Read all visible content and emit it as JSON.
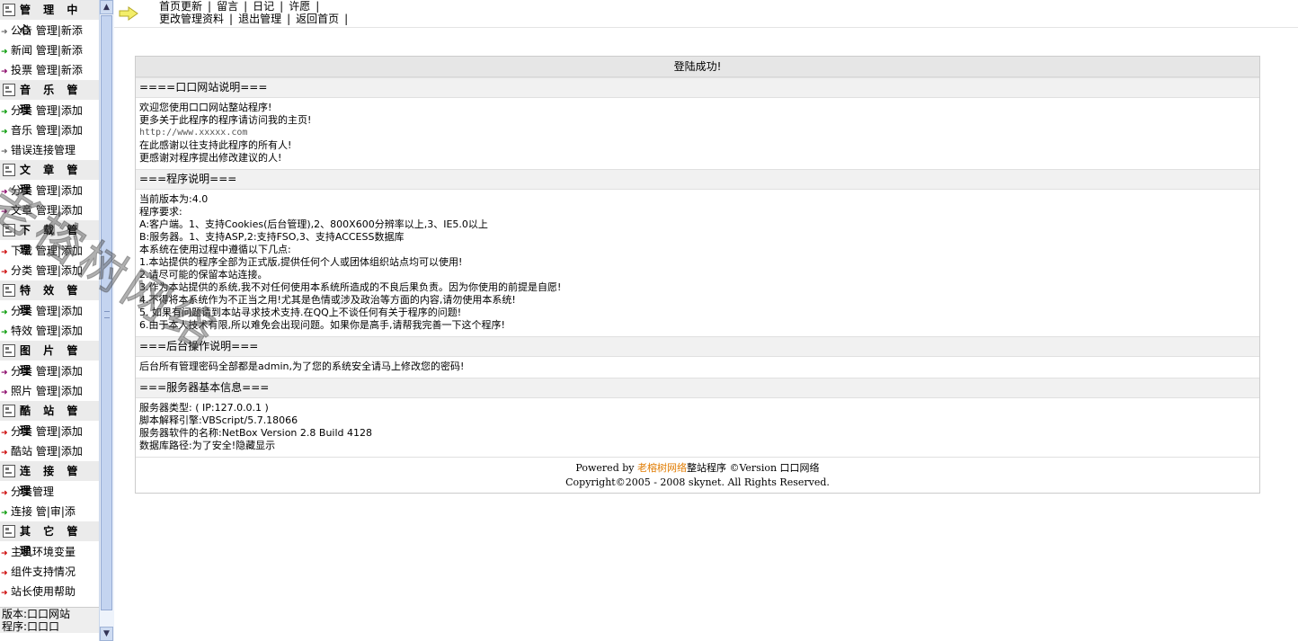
{
  "sidebar": {
    "sections": [
      {
        "title": "管 理 中 心",
        "items": [
          {
            "label": "公告 管理|新添",
            "arrow": "gray"
          },
          {
            "label": "新闻 管理|新添",
            "arrow": "green"
          },
          {
            "label": "投票 管理|新添",
            "arrow": "purple"
          }
        ]
      },
      {
        "title": "音 乐 管 理",
        "items": [
          {
            "label": "分类 管理|添加",
            "arrow": "green"
          },
          {
            "label": "音乐 管理|添加",
            "arrow": "green"
          },
          {
            "label": "错误连接管理",
            "arrow": "gray"
          }
        ]
      },
      {
        "title": "文 章 管 理",
        "items": [
          {
            "label": "分类 管理|添加",
            "arrow": "purple"
          },
          {
            "label": "文章 管理|添加",
            "arrow": "purple"
          }
        ]
      },
      {
        "title": "下 载 管 理",
        "items": [
          {
            "label": "下载 管理|添加",
            "arrow": "red"
          },
          {
            "label": "分类 管理|添加",
            "arrow": "red"
          }
        ]
      },
      {
        "title": "特 效 管 理",
        "items": [
          {
            "label": "分类 管理|添加",
            "arrow": "green"
          },
          {
            "label": "特效 管理|添加",
            "arrow": "green"
          }
        ]
      },
      {
        "title": "图 片 管 理",
        "items": [
          {
            "label": "分类 管理|添加",
            "arrow": "purple"
          },
          {
            "label": "照片 管理|添加",
            "arrow": "purple"
          }
        ]
      },
      {
        "title": "酷 站 管 理",
        "items": [
          {
            "label": "分类 管理|添加",
            "arrow": "red"
          },
          {
            "label": "酷站 管理|添加",
            "arrow": "red"
          }
        ]
      },
      {
        "title": "连 接 管 理",
        "items": [
          {
            "label": "分类管理",
            "arrow": "red"
          },
          {
            "label": "连接 管|审|添",
            "arrow": "green"
          }
        ]
      },
      {
        "title": "其 它 管 理",
        "items": [
          {
            "label": "主机环境变量",
            "arrow": "red"
          },
          {
            "label": "组件支持情况",
            "arrow": "red"
          },
          {
            "label": "站长使用帮助",
            "arrow": "red"
          }
        ]
      }
    ],
    "version_label": "版本:口口网站",
    "program_label": "程序:口口口"
  },
  "topnav": {
    "row1": [
      "首页更新",
      "留言",
      "日记",
      "许愿"
    ],
    "row2": [
      "更改管理资料",
      "退出管理",
      "返回首页"
    ]
  },
  "content": {
    "header": "登陆成功!",
    "sections": [
      {
        "title": "====口口网站说明===",
        "lines": [
          {
            "text": "欢迎您使用口口网站整站程序!"
          },
          {
            "text": "更多关于此程序的程序请访问我的主页!"
          },
          {
            "text": "http://www.xxxxx.com",
            "mono": true
          },
          {
            "text": "在此感谢以往支持此程序的所有人!"
          },
          {
            "text": "更感谢对程序提出修改建议的人!"
          }
        ]
      },
      {
        "title": "===程序说明===",
        "lines": [
          {
            "text": "当前版本为:4.0"
          },
          {
            "text": "程序要求:"
          },
          {
            "text": "A:客户端。1、支持Cookies(后台管理),2、800X600分辨率以上,3、IE5.0以上"
          },
          {
            "text": "B:服务器。1、支持ASP,2:支持FSO,3、支持ACCESS数据库"
          },
          {
            "text": "本系统在使用过程中遵循以下几点:"
          },
          {
            "text": "1.本站提供的程序全部为正式版,提供任何个人或团体组织站点均可以使用!"
          },
          {
            "text": "2.请尽可能的保留本站连接。"
          },
          {
            "text": "3.作为本站提供的系统,我不对任何使用本系统所造成的不良后果负责。因为你使用的前提是自愿!"
          },
          {
            "text": "4.不得将本系统作为不正当之用!尤其是色情或涉及政治等方面的内容,请勿使用本系统!"
          },
          {
            "text": "5. 如果有问题请到本站寻求技术支持.在QQ上不谈任何有关于程序的问题!"
          },
          {
            "text": "6.由于本人技术有限,所以难免会出现问题。如果你是高手,请帮我完善一下这个程序!"
          }
        ]
      },
      {
        "title": "===后台操作说明===",
        "lines": [
          {
            "text": "后台所有管理密码全部都是admin,为了您的系统安全请马上修改您的密码!"
          }
        ]
      },
      {
        "title": "===服务器基本信息===",
        "lines": [
          {
            "text": "服务器类型: ( IP:127.0.0.1 )"
          },
          {
            "text": "脚本解释引擎:VBScript/5.7.18066"
          },
          {
            "text": "服务器软件的名称:NetBox Version 2.8 Build 4128"
          },
          {
            "text": "数据库路径:为了安全!隐藏显示"
          }
        ]
      }
    ],
    "footer": {
      "powered_prefix": "Powered by ",
      "brand": "老榕树网络",
      "powered_suffix": "整站程序 ©Version 口口网络",
      "copyright": "Copyright©2005 - 2008 skynet. All Rights Reserved."
    }
  },
  "watermark": "老榕树网络",
  "colors": {
    "arrow_gray": "#666666",
    "arrow_red": "#cc0000",
    "arrow_green": "#009900",
    "arrow_purple": "#880066",
    "brand": "#e07b00"
  }
}
